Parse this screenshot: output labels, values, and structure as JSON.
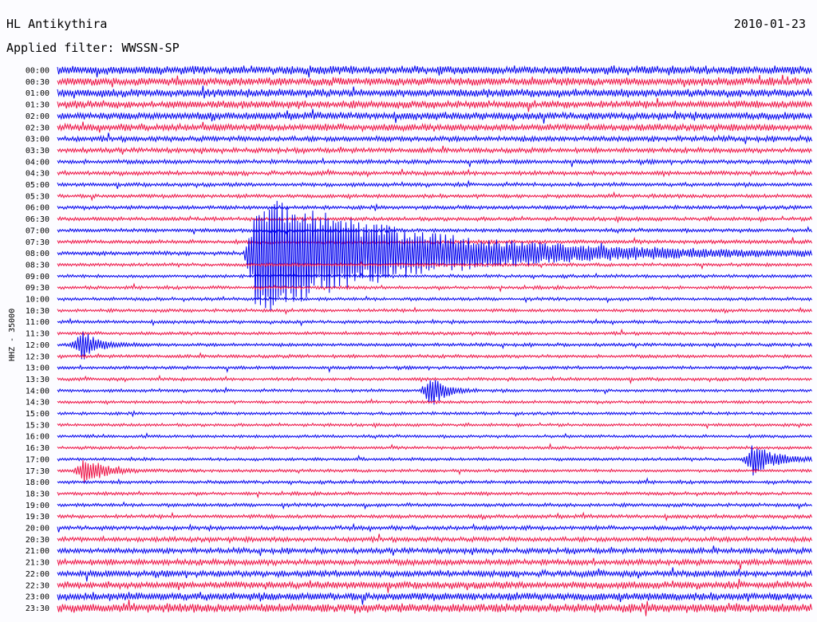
{
  "header": {
    "station": "HL Antikythira",
    "date": "2010-01-23",
    "filter": "Applied filter: WWSSN-SP",
    "channel": "HHZ - 35000"
  },
  "chart_data": {
    "type": "line",
    "title": "HL Antikythira",
    "subtitle": "Applied filter: WWSSN-SP",
    "date": "2010-01-23",
    "ylabel": "HHZ - 35000",
    "xlabel": "",
    "row_labels": [
      "00:00",
      "00:30",
      "01:00",
      "01:30",
      "02:00",
      "02:30",
      "03:00",
      "03:30",
      "04:00",
      "04:30",
      "05:00",
      "05:30",
      "06:00",
      "06:30",
      "07:00",
      "07:30",
      "08:00",
      "08:30",
      "09:00",
      "09:30",
      "10:00",
      "10:30",
      "11:00",
      "11:30",
      "12:00",
      "12:30",
      "13:00",
      "13:30",
      "14:00",
      "14:30",
      "15:00",
      "15:30",
      "16:00",
      "16:30",
      "17:00",
      "17:30",
      "18:00",
      "18:30",
      "19:00",
      "19:30",
      "20:00",
      "20:30",
      "21:00",
      "21:30",
      "22:00",
      "22:30",
      "23:00",
      "23:30"
    ],
    "row_minutes": 30,
    "trace_colors": [
      "#0000ee",
      "#ee1144"
    ],
    "noise_level": [
      1.6,
      1.5,
      1.5,
      1.4,
      1.4,
      1.3,
      1.0,
      0.9,
      0.8,
      0.8,
      0.7,
      0.7,
      0.7,
      0.7,
      0.7,
      0.7,
      0.7,
      0.6,
      0.6,
      0.6,
      0.6,
      0.6,
      0.6,
      0.6,
      0.6,
      0.6,
      0.6,
      0.6,
      0.55,
      0.55,
      0.55,
      0.55,
      0.55,
      0.55,
      0.55,
      0.55,
      0.6,
      0.6,
      0.65,
      0.7,
      0.8,
      0.9,
      1.0,
      1.1,
      1.2,
      1.3,
      1.5,
      1.7
    ],
    "events": [
      {
        "row": 16,
        "minute": 7.8,
        "peak": 8.0,
        "decay": 6.0
      },
      {
        "row": 24,
        "minute": 0.9,
        "peak": 2.2,
        "decay": 0.6
      },
      {
        "row": 28,
        "minute": 14.8,
        "peak": 2.5,
        "decay": 0.5
      },
      {
        "row": 34,
        "minute": 27.6,
        "peak": 2.2,
        "decay": 0.8
      },
      {
        "row": 35,
        "minute": 1.0,
        "peak": 1.8,
        "decay": 0.8
      }
    ]
  }
}
